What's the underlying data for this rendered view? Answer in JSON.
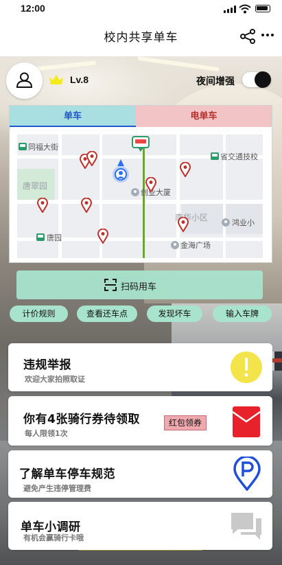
{
  "status": {
    "time": "12:00"
  },
  "header": {
    "title": "校内共享单车"
  },
  "user": {
    "level": "Lv.8",
    "night_mode_label": "夜间增强",
    "night_mode_on": true
  },
  "map": {
    "tabs": [
      {
        "label": "单车",
        "active": true
      },
      {
        "label": "电单车",
        "active": false
      }
    ],
    "labels": {
      "tongfu": "同福大街",
      "provincial": "省交通技校",
      "tangcui": "唐翠园",
      "chuangye": "创业大厦",
      "nanhua": "南华小区",
      "honghua": "鸿业小",
      "tangyuan": "唐园",
      "jinhai": "金海广场"
    }
  },
  "actions": {
    "scan_label": "扫码用车",
    "chips": [
      "计价规则",
      "查看还车点",
      "发现坏车",
      "输入车牌"
    ]
  },
  "cards": [
    {
      "title": "违规举报",
      "subtitle": "欢迎大家拍照取证",
      "icon": "exclamation-icon"
    },
    {
      "title": "你有4张骑行券待领取",
      "subtitle": "每人限领1次",
      "tag": "红包领券",
      "icon": "red-envelope-icon"
    },
    {
      "title": "了解单车停车规范",
      "subtitle": "避免产生违停管理费",
      "icon": "parking-pin-icon"
    },
    {
      "title": "单车小调研",
      "subtitle": "有机会赢骑行卡哦",
      "icon": "chat-bubbles-icon"
    }
  ],
  "colors": {
    "accent_mint": "#a8e3cd",
    "bike_tab": "#a9dfe0",
    "ebike_tab": "#f2c4c5",
    "parking_blue": "#1f4fd8",
    "alert_yellow": "#f2e44a",
    "envelope_red": "#e8222a"
  }
}
